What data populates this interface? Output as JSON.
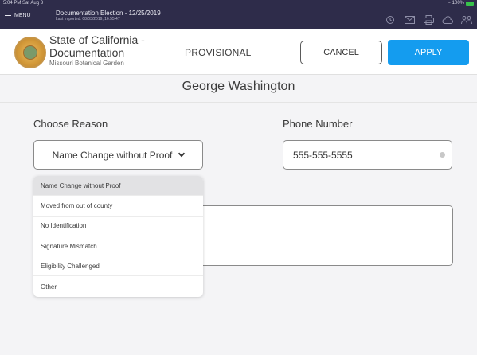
{
  "status_bar": {
    "time_date": "5:04 PM  Sat Aug 3",
    "battery": "100%"
  },
  "app_bar": {
    "menu_label": "MENU",
    "election_title": "Documentation Election - 12/25/2019",
    "last_imported": "Last Imported: 08/03/2019, 16:55:47",
    "icons": [
      "history-icon",
      "mail-icon",
      "printer-icon",
      "cloud-icon",
      "users-icon"
    ]
  },
  "header": {
    "org_name_line1": "State of California -",
    "org_name_line2": "Documentation",
    "org_location": "Missouri Botanical Garden",
    "ballot_type": "PROVISIONAL",
    "cancel_label": "CANCEL",
    "apply_label": "APPLY"
  },
  "voter": {
    "name": "George Washington"
  },
  "form": {
    "reason_label": "Choose Reason",
    "reason_selected": "Name Change without Proof",
    "phone_label": "Phone Number",
    "phone_value": "555-555-5555"
  },
  "reason_options": [
    "Name Change without Proof",
    "Moved from out of county",
    "No Identification",
    "Signature Mismatch",
    "Eligibility Challenged",
    "Other"
  ],
  "colors": {
    "topbar": "#2e2c4a",
    "accent_blue": "#149cef",
    "divider_red": "#d98a8a"
  }
}
